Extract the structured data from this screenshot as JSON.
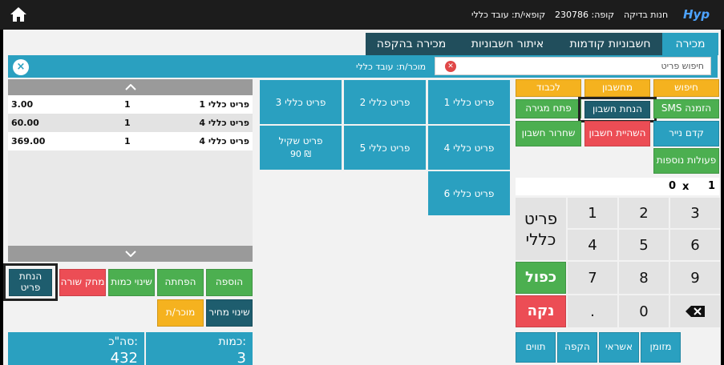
{
  "topbar": {
    "logo": "Hyp",
    "store": "חנות בדיקה",
    "register": "קופה: 230786",
    "cashier": "קופאי/ת: עובד כללי"
  },
  "tabs": [
    "מכירה",
    "חשבוניות קודמות",
    "איתור חשבוניות",
    "מכירה בהקפה"
  ],
  "search": {
    "placeholder": "חיפוש פריט",
    "salesperson": "מוכר/ת: עובד כללי"
  },
  "cart": {
    "rows": [
      {
        "name": "פריט כללי 1",
        "qty": "1",
        "price": "3.00"
      },
      {
        "name": "פריט כללי 4",
        "qty": "1",
        "price": "60.00"
      },
      {
        "name": "פריט כללי 4",
        "qty": "1",
        "price": "369.00"
      }
    ]
  },
  "cart_actions": {
    "add": "הוספה",
    "reduce": "הפחתה",
    "change_qty": "שינוי כמות",
    "delete_line": "מחק שורה",
    "item_discount": "הנחת פריט",
    "change_price": "שינוי מחיר",
    "salesperson": "מוכר/ת"
  },
  "totals": {
    "qty_label": "כמות:",
    "qty_value": "3",
    "sum_label": "סה\"כ:",
    "sum_value": "432"
  },
  "items": {
    "g1": "פריט כללי 1",
    "g2": "פריט כללי 2",
    "g3": "פריט כללי 3",
    "g4": "פריט כללי 4",
    "g5": "פריט כללי 5",
    "g6": "פריט כללי 6",
    "bag_name": "פריט שקיל",
    "bag_price": "90 ₪"
  },
  "functions": {
    "search": "חיפוש",
    "calculator": "מחשבון",
    "honor": "לכבוד",
    "sms_order": "SMS הזמנה",
    "invoice_discount": "הנחת חשבון",
    "open_drawer": "פתח מגירה",
    "paper_advance": "קדם נייר",
    "suspend_invoice": "השהיית חשבון",
    "release_invoice": "שחרור חשבון",
    "more_actions": "פעולות נוספות"
  },
  "multiplier": {
    "qty": "1",
    "sign": "x",
    "value": "0"
  },
  "keypad": {
    "k3": "3",
    "k2": "2",
    "k1": "1",
    "k6": "6",
    "k5": "5",
    "k4": "4",
    "k9": "9",
    "k8": "8",
    "k7": "7",
    "k0": "0",
    "dot": ".",
    "general_item": "פריט כללי",
    "double": "כפול",
    "clear": "נקה"
  },
  "payments": {
    "cash": "מזומן",
    "credit": "אשראי",
    "credit_account": "הקפה",
    "vouchers": "תווים"
  },
  "colors": {
    "accent": "#2aa0c0",
    "dark_tab": "#214e5c",
    "green": "#4caf50",
    "orange": "#f5b21f",
    "red": "#ec4d55"
  }
}
